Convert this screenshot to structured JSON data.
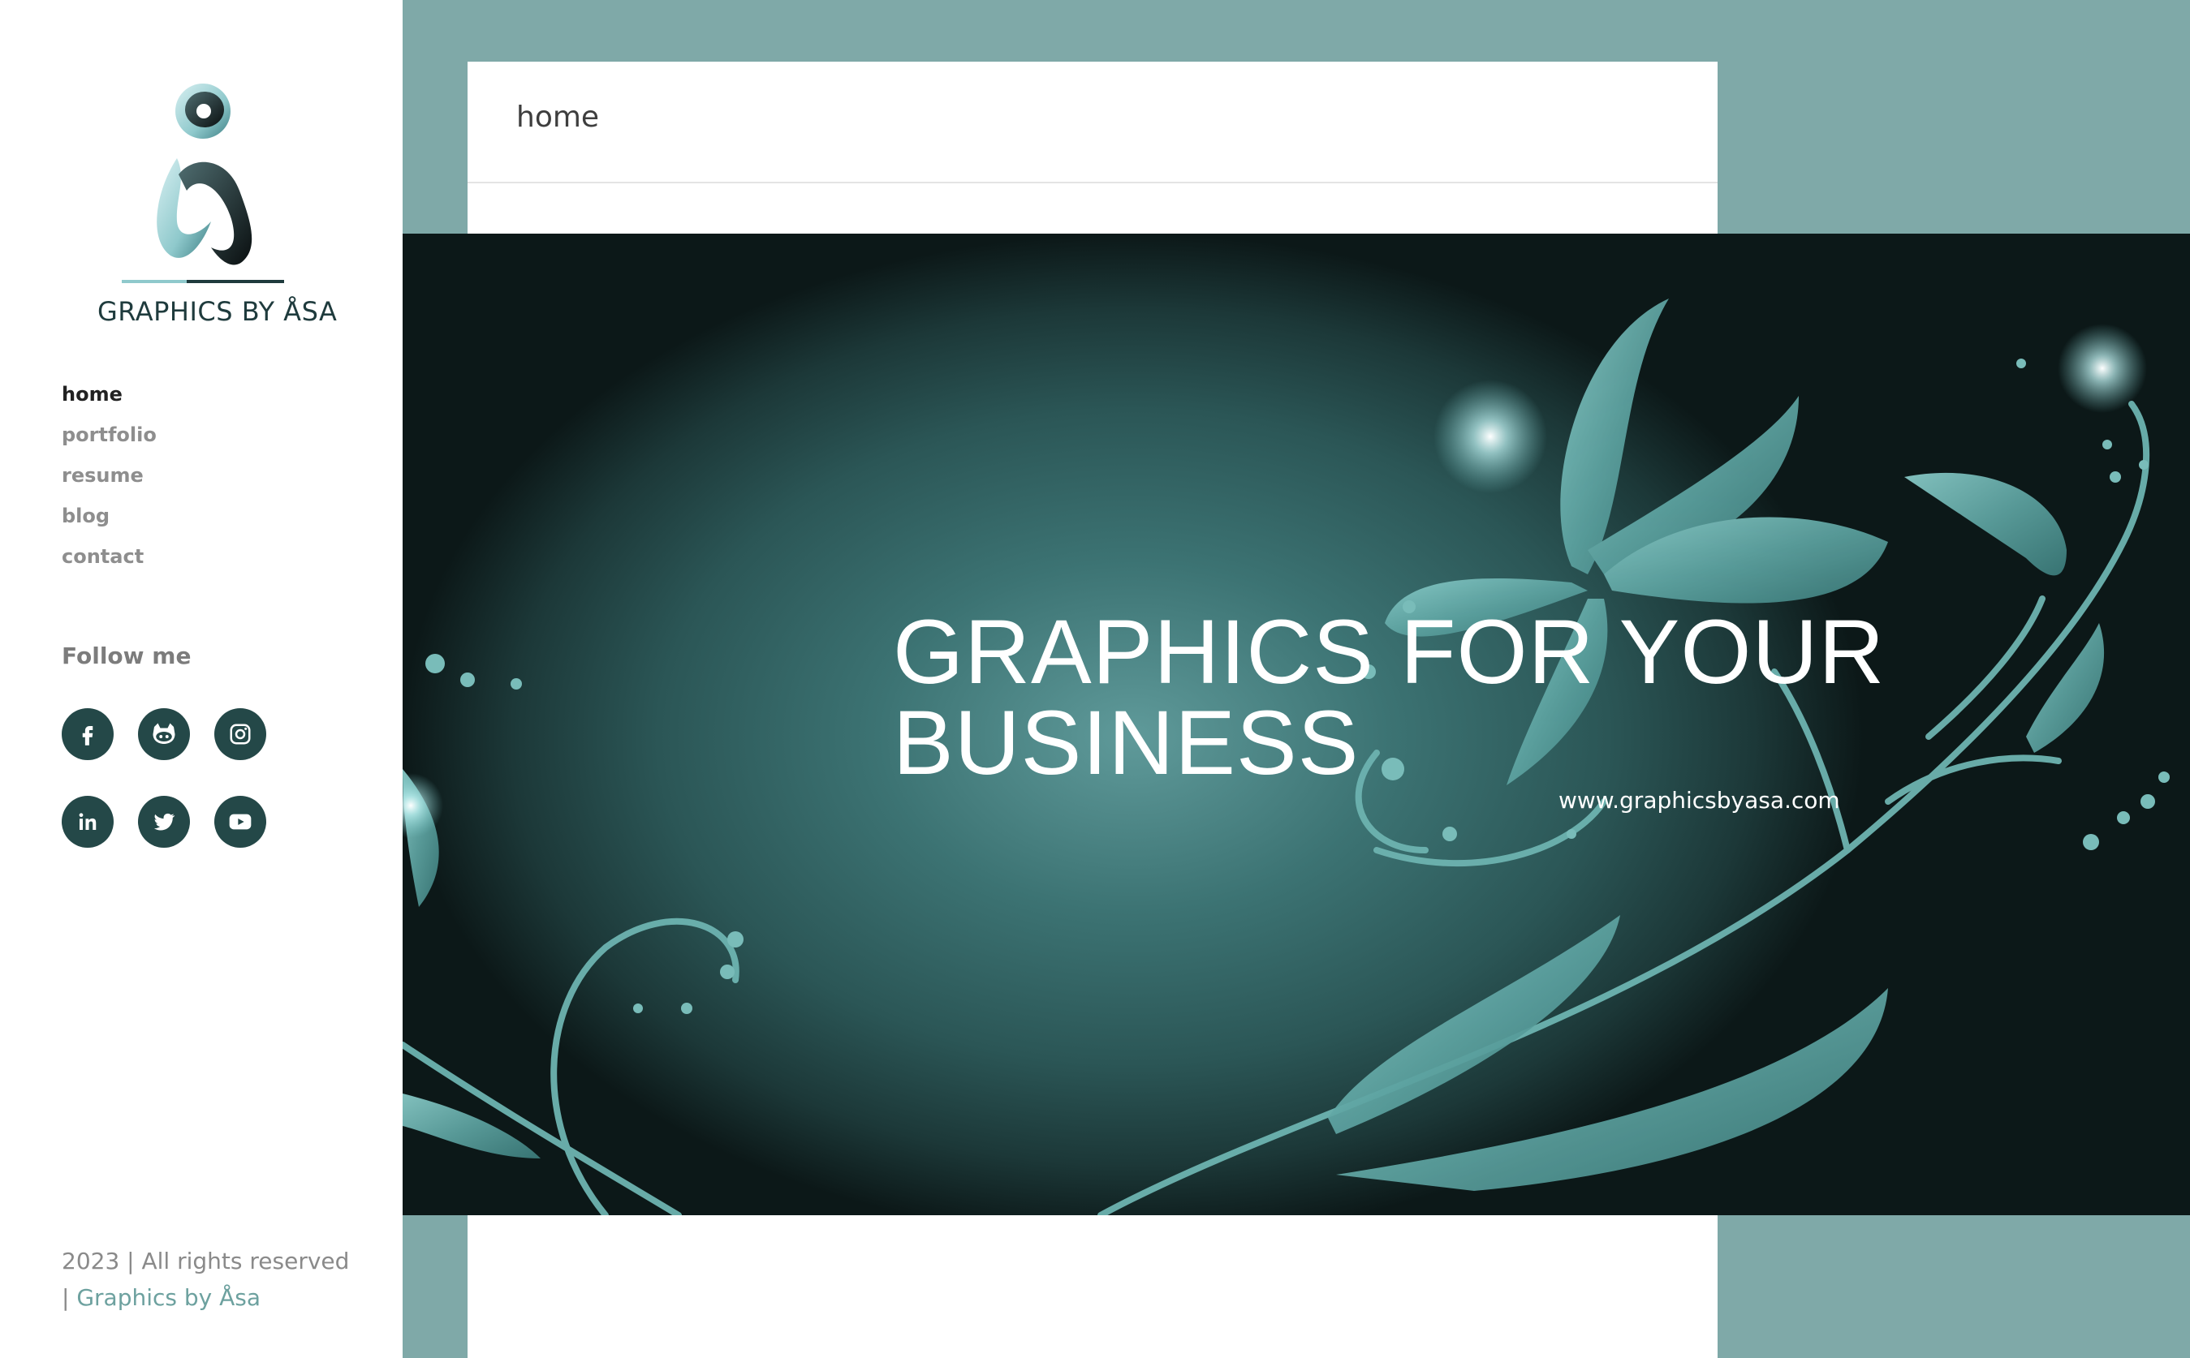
{
  "brand": {
    "name": "GRAPHICS BY ÅSA"
  },
  "nav": {
    "items": [
      {
        "label": "home",
        "active": true
      },
      {
        "label": "portfolio",
        "active": false
      },
      {
        "label": "resume",
        "active": false
      },
      {
        "label": "blog",
        "active": false
      },
      {
        "label": "contact",
        "active": false
      }
    ]
  },
  "follow": {
    "title": "Follow me",
    "icons": [
      "facebook-icon",
      "github-icon",
      "instagram-icon",
      "linkedin-icon",
      "twitter-icon",
      "youtube-icon"
    ]
  },
  "footer": {
    "copyright": "2023 | All rights reserved",
    "separator": "|",
    "link_label": "Graphics by Åsa"
  },
  "page": {
    "title": "home"
  },
  "hero": {
    "heading_line1": "GRAPHICS FOR YOUR",
    "heading_line2": "BUSINESS",
    "url": "www.graphicsbyasa.com"
  },
  "colors": {
    "accent": "#7fa9a8",
    "social_bg": "#244848",
    "link": "#6da19f"
  }
}
